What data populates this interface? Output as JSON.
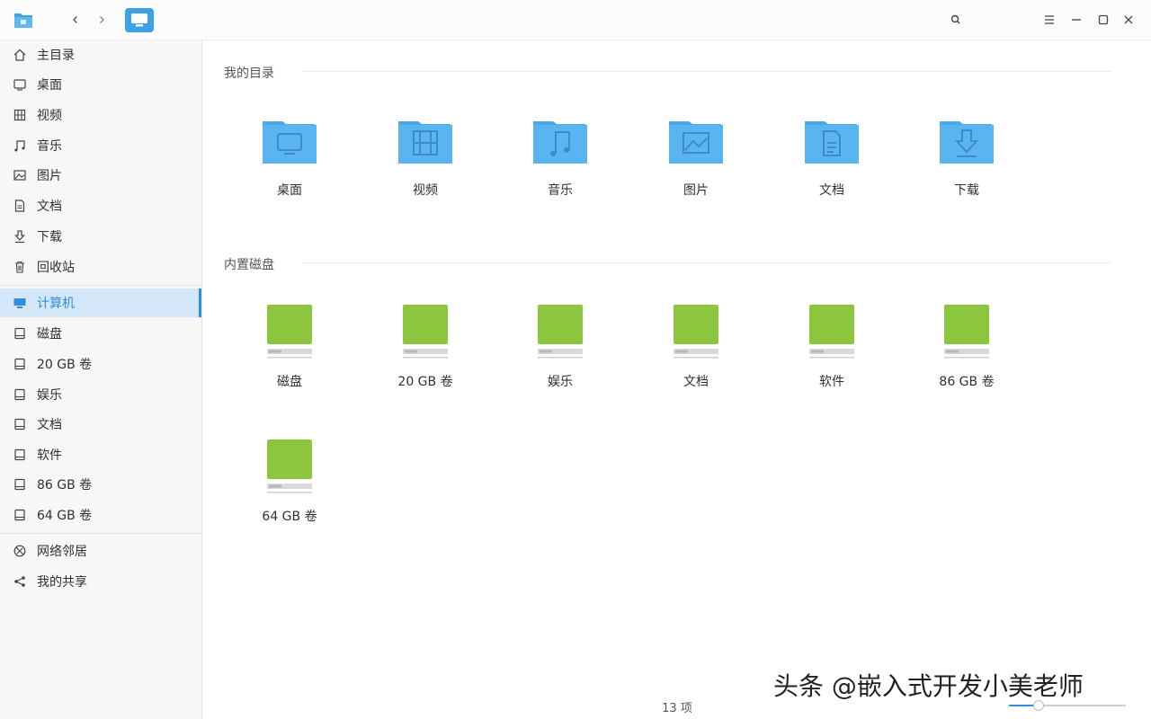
{
  "status_text": "13 项",
  "watermark": "头条 @嵌入式开发小美老师",
  "sidebar": {
    "items": [
      {
        "label": "主目录",
        "icon": "home-icon"
      },
      {
        "label": "桌面",
        "icon": "desktop-icon"
      },
      {
        "label": "视频",
        "icon": "video-icon"
      },
      {
        "label": "音乐",
        "icon": "music-icon"
      },
      {
        "label": "图片",
        "icon": "picture-icon"
      },
      {
        "label": "文档",
        "icon": "document-icon"
      },
      {
        "label": "下载",
        "icon": "download-icon"
      },
      {
        "label": "回收站",
        "icon": "trash-icon"
      },
      {
        "label": "计算机",
        "icon": "computer-icon",
        "active": true
      },
      {
        "label": "磁盘",
        "icon": "drive-icon"
      },
      {
        "label": "20 GB 卷",
        "icon": "drive-icon"
      },
      {
        "label": "娱乐",
        "icon": "drive-icon"
      },
      {
        "label": "文档",
        "icon": "drive-icon"
      },
      {
        "label": "软件",
        "icon": "drive-icon"
      },
      {
        "label": "86 GB 卷",
        "icon": "drive-icon"
      },
      {
        "label": "64 GB 卷",
        "icon": "drive-icon"
      },
      {
        "label": "网络邻居",
        "icon": "network-icon"
      },
      {
        "label": "我的共享",
        "icon": "share-icon"
      }
    ]
  },
  "main": {
    "sections": [
      {
        "title": "我的目录",
        "items": [
          {
            "label": "桌面",
            "icon": "desktop-folder-icon"
          },
          {
            "label": "视频",
            "icon": "video-folder-icon"
          },
          {
            "label": "音乐",
            "icon": "music-folder-icon"
          },
          {
            "label": "图片",
            "icon": "picture-folder-icon"
          },
          {
            "label": "文档",
            "icon": "document-folder-icon"
          },
          {
            "label": "下载",
            "icon": "download-folder-icon"
          }
        ]
      },
      {
        "title": "内置磁盘",
        "items": [
          {
            "label": "磁盘",
            "icon": "drive-icon"
          },
          {
            "label": "20 GB 卷",
            "icon": "drive-icon"
          },
          {
            "label": "娱乐",
            "icon": "drive-icon"
          },
          {
            "label": "文档",
            "icon": "drive-icon"
          },
          {
            "label": "软件",
            "icon": "drive-icon"
          },
          {
            "label": "86 GB 卷",
            "icon": "drive-icon"
          },
          {
            "label": "64 GB 卷",
            "icon": "drive-icon"
          }
        ]
      }
    ]
  },
  "colors": {
    "accent": "#2f8ee0",
    "folder": "#5ab4ef",
    "drive": "#8cc63f"
  },
  "zoom_level": 0.25
}
